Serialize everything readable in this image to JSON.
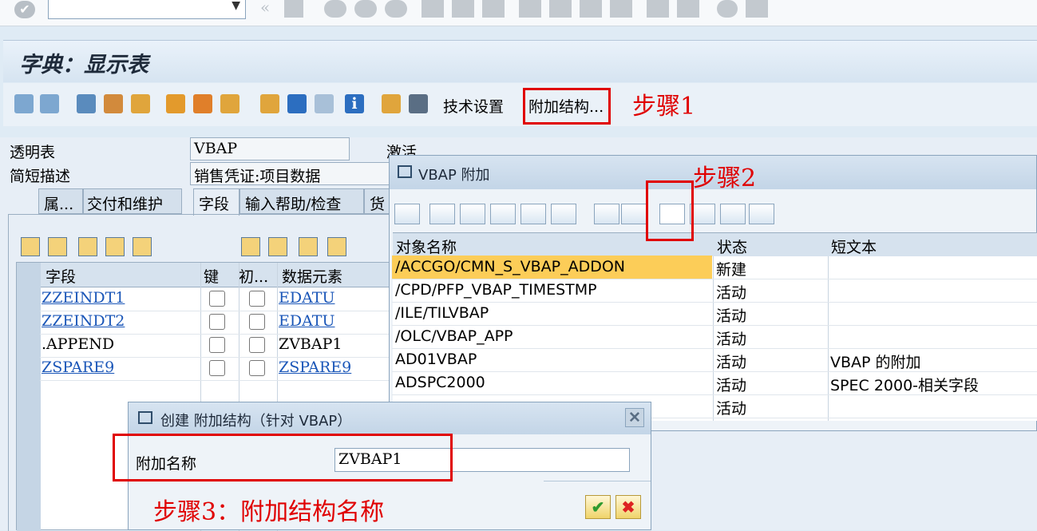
{
  "title": "字典：显示表",
  "toolbar": {
    "tech_settings": "技术设置",
    "append_structure": "附加结构..."
  },
  "steps": {
    "step1": "步骤1",
    "step2": "步骤2",
    "step3": "步骤3：附加结构名称"
  },
  "header": {
    "transparent_table_label": "透明表",
    "transparent_table_value": "VBAP",
    "short_desc_label": "简短描述",
    "short_desc_value": "销售凭证:项目数据",
    "status_text": "激活"
  },
  "tabs": [
    "属...",
    "交付和维护",
    "字段",
    "输入帮助/检查",
    "货"
  ],
  "fields_table": {
    "headers": [
      "字段",
      "键",
      "初...",
      "数据元素"
    ],
    "rows": [
      {
        "field": "ZZEINDT1",
        "element": "EDATU"
      },
      {
        "field": "ZZEINDT2",
        "element": "EDATU"
      },
      {
        "field": ".APPEND",
        "element": "ZVBAP1"
      },
      {
        "field": "ZSPARE9",
        "element": "ZSPARE9"
      }
    ]
  },
  "append_dialog": {
    "title": "VBAP 附加",
    "headers": [
      "对象名称",
      "状态",
      "短文本"
    ],
    "rows": [
      {
        "name": "/ACCGO/CMN_S_VBAP_ADDON",
        "status": "新建",
        "text": ""
      },
      {
        "name": "/CPD/PFP_VBAP_TIMESTMP",
        "status": "活动",
        "text": ""
      },
      {
        "name": "/ILE/TILVBAP",
        "status": "活动",
        "text": ""
      },
      {
        "name": "/OLC/VBAP_APP",
        "status": "活动",
        "text": ""
      },
      {
        "name": "AD01VBAP",
        "status": "活动",
        "text": "VBAP 的附加"
      },
      {
        "name": "ADSPC2000",
        "status": "活动",
        "text": "SPEC 2000-相关字段"
      },
      {
        "name": "",
        "status": "活动",
        "text": ""
      }
    ]
  },
  "create_dialog": {
    "title": "创建 附加结构（针对 VBAP）",
    "field_label": "附加名称",
    "field_value": "ZVBAP1"
  },
  "colors": {
    "accent_red": "#e00000",
    "highlight": "#fccd58"
  }
}
